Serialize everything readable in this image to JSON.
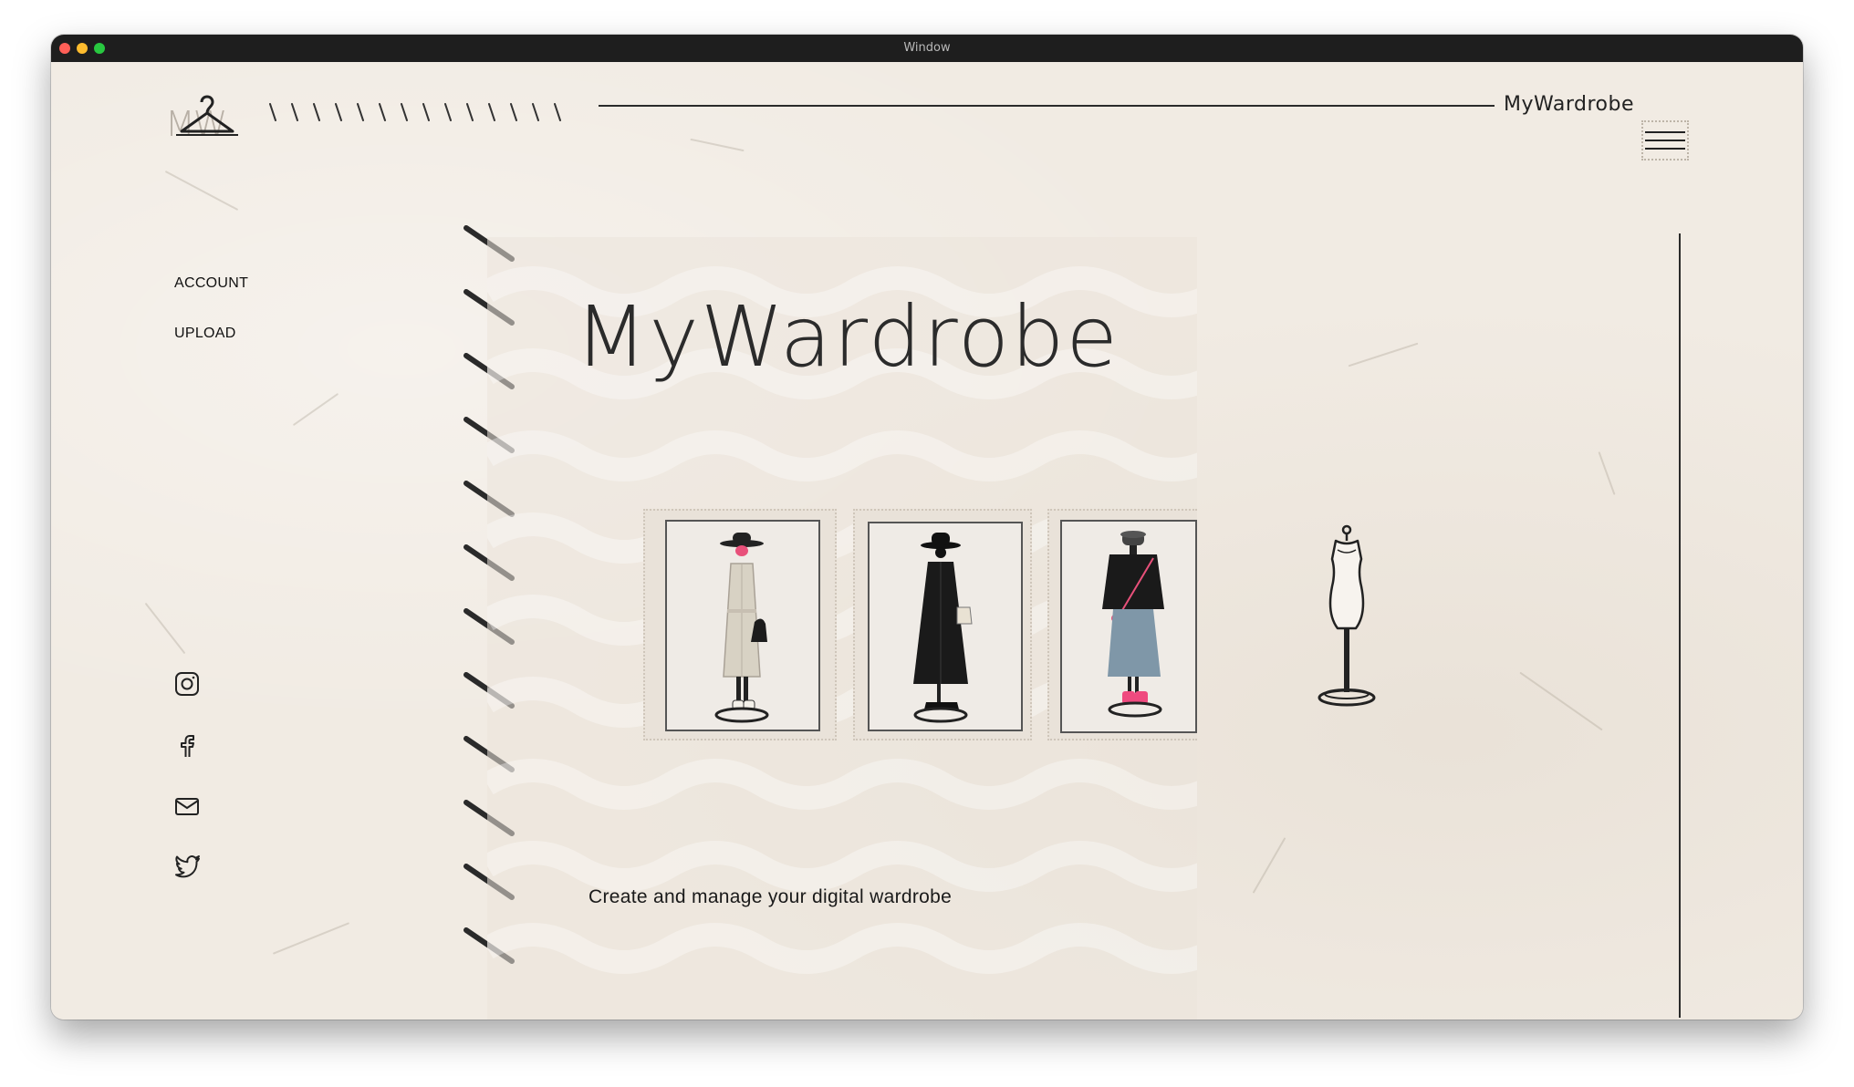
{
  "window": {
    "title": "Window"
  },
  "header": {
    "brand": "MyWardrobe",
    "logo_icon": "hanger-icon",
    "logo_letters": "MW",
    "menu_icon": "hamburger-menu-icon"
  },
  "sidebar": {
    "nav": [
      {
        "label": "ACCOUNT"
      },
      {
        "label": "UPLOAD"
      }
    ],
    "social": [
      {
        "icon": "instagram-icon"
      },
      {
        "icon": "facebook-icon"
      },
      {
        "icon": "mail-icon"
      },
      {
        "icon": "twitter-icon"
      }
    ]
  },
  "hero": {
    "title": "MyWardrobe",
    "tagline": "Create and manage your digital wardrobe",
    "outfits": [
      {
        "icon": "beige-trench-coat-outfit"
      },
      {
        "icon": "black-coat-dress-outfit"
      },
      {
        "icon": "black-sweater-denim-skirt-outfit"
      }
    ],
    "decor_icon": "dress-form-mannequin-icon"
  },
  "colors": {
    "paper": "#f1ebe3",
    "ink": "#222222",
    "accent_pink": "#e8507a"
  }
}
